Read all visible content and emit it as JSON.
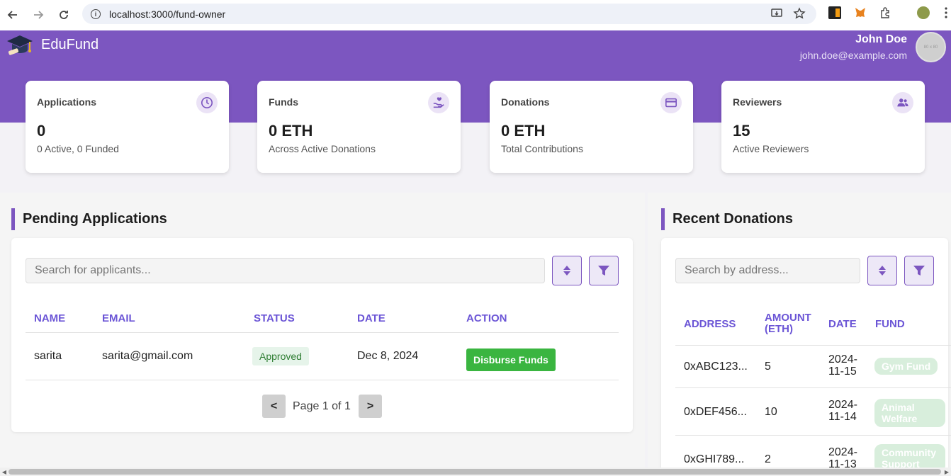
{
  "browser": {
    "url": "localhost:3000/fund-owner"
  },
  "header": {
    "brand": "EduFund",
    "user_name": "John Doe",
    "user_email": "john.doe@example.com",
    "avatar_text": "80 x 80"
  },
  "stats": [
    {
      "title": "Applications",
      "value": "0",
      "sub": "0 Active, 0 Funded",
      "icon": "clock-icon"
    },
    {
      "title": "Funds",
      "value": "0 ETH",
      "sub": "Across Active Donations",
      "icon": "hand-heart-icon"
    },
    {
      "title": "Donations",
      "value": "0 ETH",
      "sub": "Total Contributions",
      "icon": "credit-card-icon"
    },
    {
      "title": "Reviewers",
      "value": "15",
      "sub": "Active Reviewers",
      "icon": "people-icon"
    }
  ],
  "pending": {
    "title": "Pending Applications",
    "search_placeholder": "Search for applicants...",
    "columns": [
      "NAME",
      "EMAIL",
      "STATUS",
      "DATE",
      "ACTION"
    ],
    "rows": [
      {
        "name": "sarita",
        "email": "sarita@gmail.com",
        "status": "Approved",
        "date": "Dec 8, 2024",
        "action": "Disburse Funds"
      }
    ],
    "pagination": {
      "prev": "<",
      "text": "Page 1 of 1",
      "next": ">"
    }
  },
  "donations": {
    "title": "Recent Donations",
    "search_placeholder": "Search by address...",
    "columns": [
      "ADDRESS",
      "AMOUNT (ETH)",
      "DATE",
      "FUND"
    ],
    "rows": [
      {
        "address": "0xABC123...",
        "amount": "5",
        "date": "2024-11-15",
        "fund": "Gym Fund"
      },
      {
        "address": "0xDEF456...",
        "amount": "10",
        "date": "2024-11-14",
        "fund": "Animal Welfare"
      },
      {
        "address": "0xGHI789...",
        "amount": "2",
        "date": "2024-11-13",
        "fund": "Community Support"
      }
    ]
  },
  "colors": {
    "accent": "#7c56c0",
    "table_header": "#6b55d6",
    "success": "#3ab540"
  }
}
